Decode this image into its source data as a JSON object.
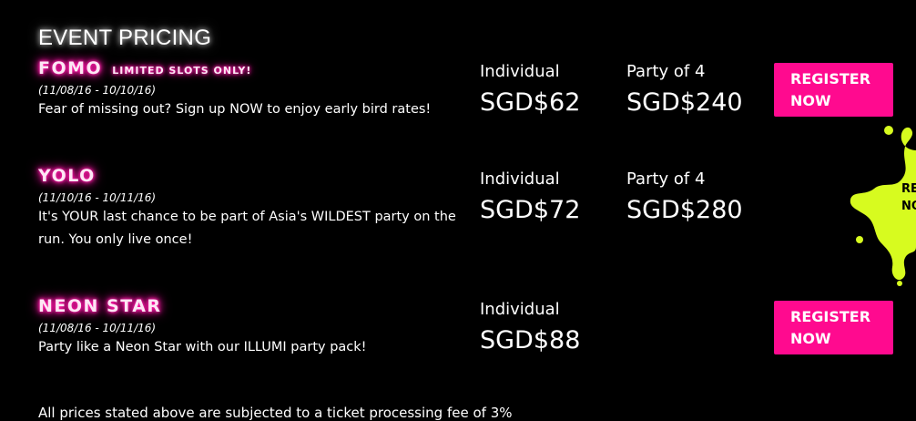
{
  "page_title": "EVENT PRICING",
  "tiers": [
    {
      "name": "FOMO",
      "tag": "LIMITED SLOTS ONLY!",
      "dates": "(11/08/16 - 10/10/16)",
      "description": "Fear of missing out? Sign up NOW to enjoy early bird rates!",
      "individual_label": "Individual",
      "individual_price": "SGD$62",
      "party_label": "Party of 4",
      "party_price": "SGD$240",
      "button_label": "REGISTER NOW"
    },
    {
      "name": "YOLO",
      "dates": "(11/10/16 - 10/11/16)",
      "description": "It's YOUR last chance to be part of Asia's WILDEST party on the run. You only live once!",
      "individual_label": "Individual",
      "individual_price": "SGD$72",
      "party_label": "Party of 4",
      "party_price": "SGD$280"
    },
    {
      "name": "NEON STAR",
      "dates": "(11/08/16 - 10/11/16)",
      "description": "Party like a Neon Star with our ILLUMI party pack!",
      "individual_label": "Individual",
      "individual_price": "SGD$88",
      "button_label": "REGISTER NOW"
    }
  ],
  "splat_badge": {
    "text_line1": "RE",
    "text_line2": "NO",
    "color": "#d7fb1f"
  },
  "footnote": "All prices stated above are subjected to a ticket processing fee of 3%",
  "colors": {
    "accent_pink": "#ff0a8f",
    "background": "#000000",
    "neon_green": "#d7fb1f"
  }
}
